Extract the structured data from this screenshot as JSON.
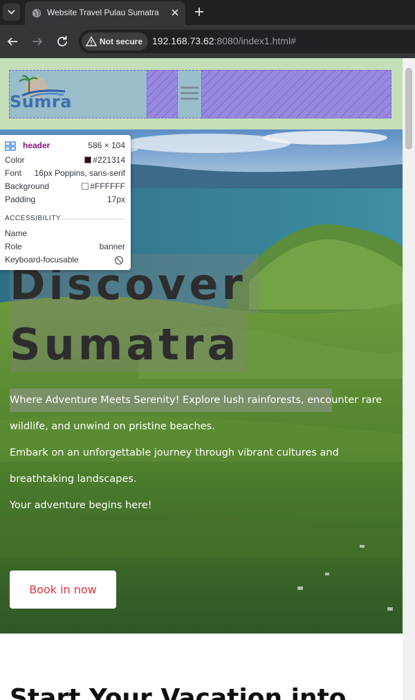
{
  "browser": {
    "tab": {
      "title": "Website Travel Pulau Sumatra"
    },
    "omnibox": {
      "security_label": "Not secure",
      "url_host": "192.168.73.62",
      "url_rest": ":8080/index1.html#"
    }
  },
  "page": {
    "header": {
      "logo_text": "Sumra"
    },
    "hero": {
      "title_line1": "Discover",
      "title_line2": "Sumatra",
      "description_1": "Where Adventure Meets Serenity! Explore lush rainforests, encounter rare wildlife, and unwind on pristine beaches.",
      "description_2": "Embark on an unforgettable journey through vibrant cultures and breathtaking landscapes.",
      "description_3": "Your adventure begins here!",
      "cta_label": "Book in now"
    },
    "next_section_title": "Start Your Vacation into"
  },
  "devtools_tooltip": {
    "element_tag": "header",
    "element_size": "586 × 104",
    "rows": [
      {
        "key": "Color",
        "value": "#221314"
      },
      {
        "key": "Font",
        "value": "16px Poppins, sans-serif"
      },
      {
        "key": "Background",
        "value": "#FFFFFF"
      },
      {
        "key": "Padding",
        "value": "17px"
      }
    ],
    "accessibility_heading": "ACCESSIBILITY",
    "a11y_rows": [
      {
        "key": "Name",
        "value": ""
      },
      {
        "key": "Role",
        "value": "banner"
      },
      {
        "key": "Keyboard-focusable",
        "value": ""
      }
    ]
  },
  "colors": {
    "chrome_dark": "#202124",
    "chrome_tab": "#35363a",
    "cta_text": "#e0333a",
    "header_highlight": "#93c47d",
    "tag_purple": "#881280"
  }
}
